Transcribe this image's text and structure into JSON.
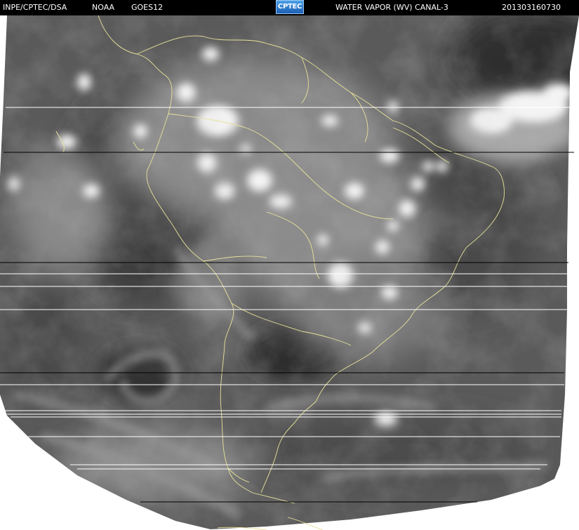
{
  "header": {
    "org": "INPE/CPTEC/DSA",
    "agency": "NOAA",
    "satellite": "GOES12",
    "logo_text": "CPTEC",
    "channel": "WATER VAPOR  (WV)  CANAL-3",
    "timestamp": "201303160730"
  },
  "colors": {
    "header_bg": "#000000",
    "header_text": "#ffffff",
    "coastline": "#e8e29a",
    "background": "#ffffff"
  }
}
